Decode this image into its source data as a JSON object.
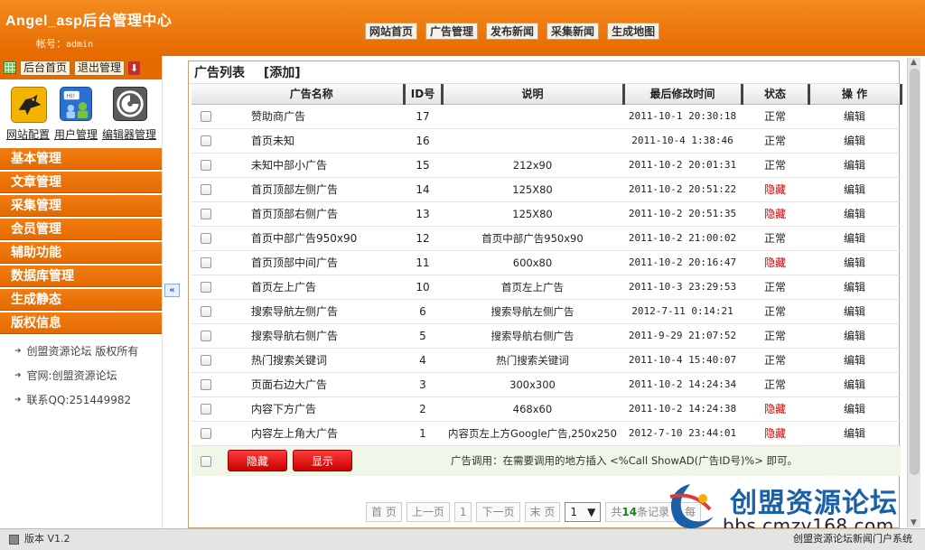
{
  "header": {
    "title": "Angel_asp后台管理中心",
    "account_label": "帐号：",
    "account_value": "admin",
    "nav": [
      "网站首页",
      "广告管理",
      "发布新闻",
      "采集新闻",
      "生成地图"
    ]
  },
  "sidebar": {
    "top_buttons": [
      "后台首页",
      "退出管理"
    ],
    "tools": [
      "网站配置",
      "用户管理",
      "编辑器管理"
    ],
    "menu": [
      "基本管理",
      "文章管理",
      "采集管理",
      "会员管理",
      "辅助功能",
      "数据库管理",
      "生成静态",
      "版权信息"
    ],
    "info": [
      "创盟资源论坛 版权所有",
      "官网:创盟资源论坛",
      "联系QQ:251449982"
    ]
  },
  "main": {
    "title": "广告列表",
    "add_link": "[添加]",
    "columns": [
      "广告名称",
      "ID号",
      "说明",
      "最后修改时间",
      "状态",
      "操  作"
    ],
    "rows": [
      {
        "name": "赞助商广告",
        "id": "17",
        "desc": "",
        "time": "2011-10-1 20:30:18",
        "status": "正常",
        "hidden": false,
        "op": "编辑"
      },
      {
        "name": "首页未知",
        "id": "16",
        "desc": "",
        "time": "2011-10-4 1:38:46",
        "status": "正常",
        "hidden": false,
        "op": "编辑"
      },
      {
        "name": "未知中部小广告",
        "id": "15",
        "desc": "212x90",
        "time": "2011-10-2 20:01:31",
        "status": "正常",
        "hidden": false,
        "op": "编辑"
      },
      {
        "name": "首页顶部左侧广告",
        "id": "14",
        "desc": "125X80",
        "time": "2011-10-2 20:51:22",
        "status": "隐藏",
        "hidden": true,
        "op": "编辑"
      },
      {
        "name": "首页顶部右侧广告",
        "id": "13",
        "desc": "125X80",
        "time": "2011-10-2 20:51:35",
        "status": "隐藏",
        "hidden": true,
        "op": "编辑"
      },
      {
        "name": "首页中部广告950x90",
        "id": "12",
        "desc": "首页中部广告950x90",
        "time": "2011-10-2 21:00:02",
        "status": "正常",
        "hidden": false,
        "op": "编辑"
      },
      {
        "name": "首页顶部中间广告",
        "id": "11",
        "desc": "600x80",
        "time": "2011-10-2 20:16:47",
        "status": "隐藏",
        "hidden": true,
        "op": "编辑"
      },
      {
        "name": "首页左上广告",
        "id": "10",
        "desc": "首页左上广告",
        "time": "2011-10-3 23:29:53",
        "status": "正常",
        "hidden": false,
        "op": "编辑"
      },
      {
        "name": "搜索导航左侧广告",
        "id": "6",
        "desc": "搜索导航左侧广告",
        "time": "2012-7-11 0:14:21",
        "status": "正常",
        "hidden": false,
        "op": "编辑"
      },
      {
        "name": "搜索导航右侧广告",
        "id": "5",
        "desc": "搜索导航右侧广告",
        "time": "2011-9-29 21:07:52",
        "status": "正常",
        "hidden": false,
        "op": "编辑"
      },
      {
        "name": "热门搜索关键词",
        "id": "4",
        "desc": "热门搜索关键词",
        "time": "2011-10-4 15:40:07",
        "status": "正常",
        "hidden": false,
        "op": "编辑"
      },
      {
        "name": "页面右边大广告",
        "id": "3",
        "desc": "300x300",
        "time": "2011-10-2 14:24:34",
        "status": "正常",
        "hidden": false,
        "op": "编辑"
      },
      {
        "name": "内容下方广告",
        "id": "2",
        "desc": "468x60",
        "time": "2011-10-2 14:24:38",
        "status": "隐藏",
        "hidden": true,
        "op": "编辑"
      },
      {
        "name": "内容左上角大广告",
        "id": "1",
        "desc": "内容页左上方Google广告,250x250",
        "time": "2012-7-10 23:44:01",
        "status": "隐藏",
        "hidden": true,
        "op": "编辑"
      }
    ],
    "btn_hide": "隐藏",
    "btn_show": "显示",
    "hint": "广告调用：在需要调用的地方插入 <%Call ShowAD(广告ID号)%> 即可。"
  },
  "pager": {
    "first": "首  页",
    "prev": "上一页",
    "current": "1",
    "next": "下一页",
    "last": "末  页",
    "select_value": "1",
    "total_prefix": "共",
    "total_count": "14",
    "total_suffix": "条记录",
    "per_page": "每"
  },
  "footer": {
    "version": "版本 V1.2",
    "system": "创盟资源论坛新闻门户系统"
  },
  "watermark": {
    "cn": "创盟资源论坛",
    "url": "bbs.cmzy168.com"
  }
}
